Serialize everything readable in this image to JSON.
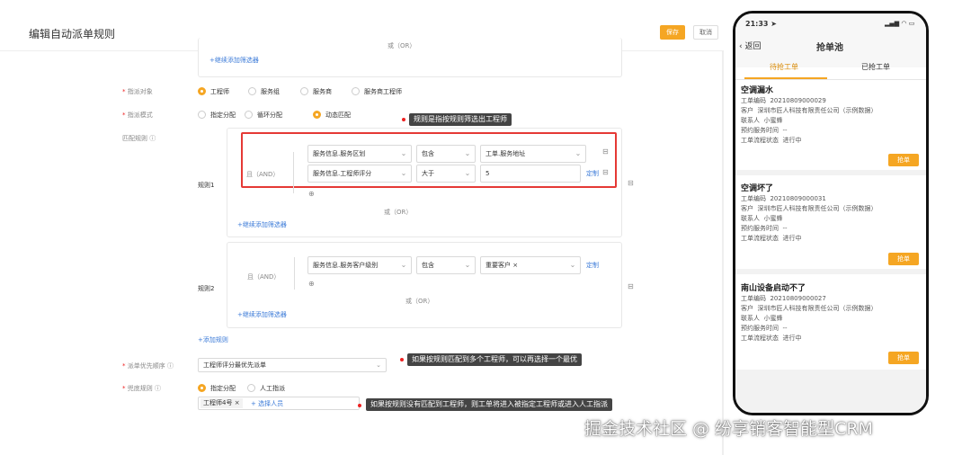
{
  "editor": {
    "title": "编辑自动派单规则",
    "save": "保存",
    "cancel": "取消",
    "or_label": "或（OR）",
    "and_label": "且（AND）",
    "add_filter": "+继续添加筛选器",
    "target": {
      "label": "指派对象",
      "options": [
        "工程师",
        "服务组",
        "服务商",
        "服务商工程师"
      ],
      "selected": "工程师"
    },
    "mode": {
      "label": "指派模式",
      "options": [
        "指定分配",
        "循环分配",
        "动态匹配"
      ],
      "selected": "动态匹配"
    },
    "rule_section_label": "匹配规则",
    "rule1": {
      "name": "规则1",
      "row1": {
        "field": "服务信息.服务区划",
        "op": "包含",
        "value": "工单.服务地址"
      },
      "row2": {
        "field": "服务信息.工程师评分",
        "op": "大于",
        "value": "5",
        "link": "定制"
      }
    },
    "rule2": {
      "name": "规则2",
      "row1": {
        "field": "服务信息.服务客户级别",
        "op": "包含",
        "value": "重要客户 ×",
        "link": "定制"
      }
    },
    "add_rule": "+添加规则",
    "priority": {
      "label": "派单优先顺序",
      "value": "工程师评分最优先派单"
    },
    "fallback": {
      "label": "兜底规则",
      "options": [
        "指定分配",
        "人工指派"
      ],
      "selected": "指定分配",
      "tag": "工程师4号",
      "add_person": "+ 选择人员"
    },
    "callouts": {
      "c1": "规则是指按规则筛选出工程师",
      "c2": "如果按规则匹配到多个工程师，可以再选择一个最优",
      "c3": "如果按规则没有匹配到工程师，则工单将进入被指定工程师或进入人工指派"
    }
  },
  "phone": {
    "time": "21:33",
    "back": "返回",
    "title": "抢单池",
    "tabs": [
      "待抢工单",
      "已抢工单"
    ],
    "active_tab": 0,
    "grab_label": "抢单",
    "field_labels": {
      "number": "工单编码",
      "customer": "客户",
      "contact": "联系人",
      "appointment": "预约服务时间",
      "status": "工单流程状态"
    },
    "cards": [
      {
        "title": "空调漏水",
        "number": "20210809000029",
        "customer": "深圳市匠人科技有限责任公司（示例数据）",
        "contact": "小蜜蜂",
        "appointment": "--",
        "status": "进行中"
      },
      {
        "title": "空调坏了",
        "number": "20210809000031",
        "customer": "深圳市匠人科技有限责任公司（示例数据）",
        "contact": "小蜜蜂",
        "appointment": "--",
        "status": "进行中"
      },
      {
        "title": "南山设备启动不了",
        "number": "20210809000027",
        "customer": "深圳市匠人科技有限责任公司（示例数据）",
        "contact": "小蜜蜂",
        "appointment": "--",
        "status": "进行中"
      }
    ]
  },
  "credit": "掘金技术社区 @ 纷享销客智能型CRM",
  "colors": {
    "accent": "#f5a623",
    "highlight": "#e53935",
    "link": "#3c7bd8"
  }
}
